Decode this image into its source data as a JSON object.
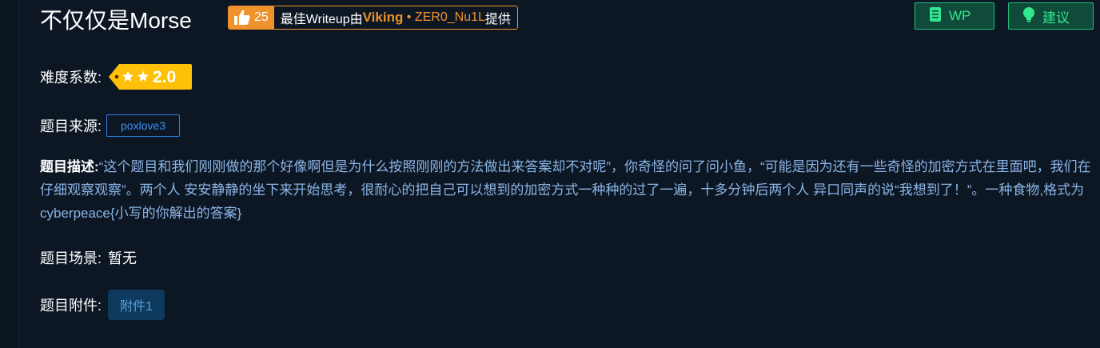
{
  "challenge": {
    "title": "不仅仅是Morse"
  },
  "writeup_badge": {
    "likes": "25",
    "prefix": "最佳Writeup由",
    "author": "Viking",
    "separator": " • ",
    "others": "ZER0_Nu1L",
    "suffix": "提供",
    "like_icon": "thumbs-up-icon"
  },
  "actions": {
    "wp_label": "WP",
    "wp_icon": "book-icon",
    "suggest_label": "建议",
    "suggest_icon": "lightbulb-icon"
  },
  "difficulty": {
    "label": "难度系数:",
    "value": "2.0",
    "stars": 2,
    "tag_color": "#ffc107"
  },
  "source": {
    "label": "题目来源:",
    "value": "poxlove3"
  },
  "description": {
    "label": "题目描述:",
    "text": "“这个题目和我们刚刚做的那个好像啊但是为什么按照刚刚的方法做出来答案却不对呢”，你奇怪的问了问小鱼，“可能是因为还有一些奇怪的加密方式在里面吧，我们在仔细观察观察”。两个人 安安静静的坐下来开始思考，很耐心的把自己可以想到的加密方式一种种的过了一遍，十多分钟后两个人 异口同声的说“我想到了！”。一种食物,格式为cyberpeace{小写的你解出的答案}"
  },
  "scene": {
    "label": "题目场景:",
    "value": "暂无"
  },
  "attachment": {
    "label": "题目附件:",
    "button": "附件1"
  },
  "colors": {
    "background": "#0d1724",
    "accent_orange": "#f0922c",
    "accent_green": "#31e88f",
    "link_blue": "#3d8ff0",
    "desc_text": "#8ab4e6"
  }
}
